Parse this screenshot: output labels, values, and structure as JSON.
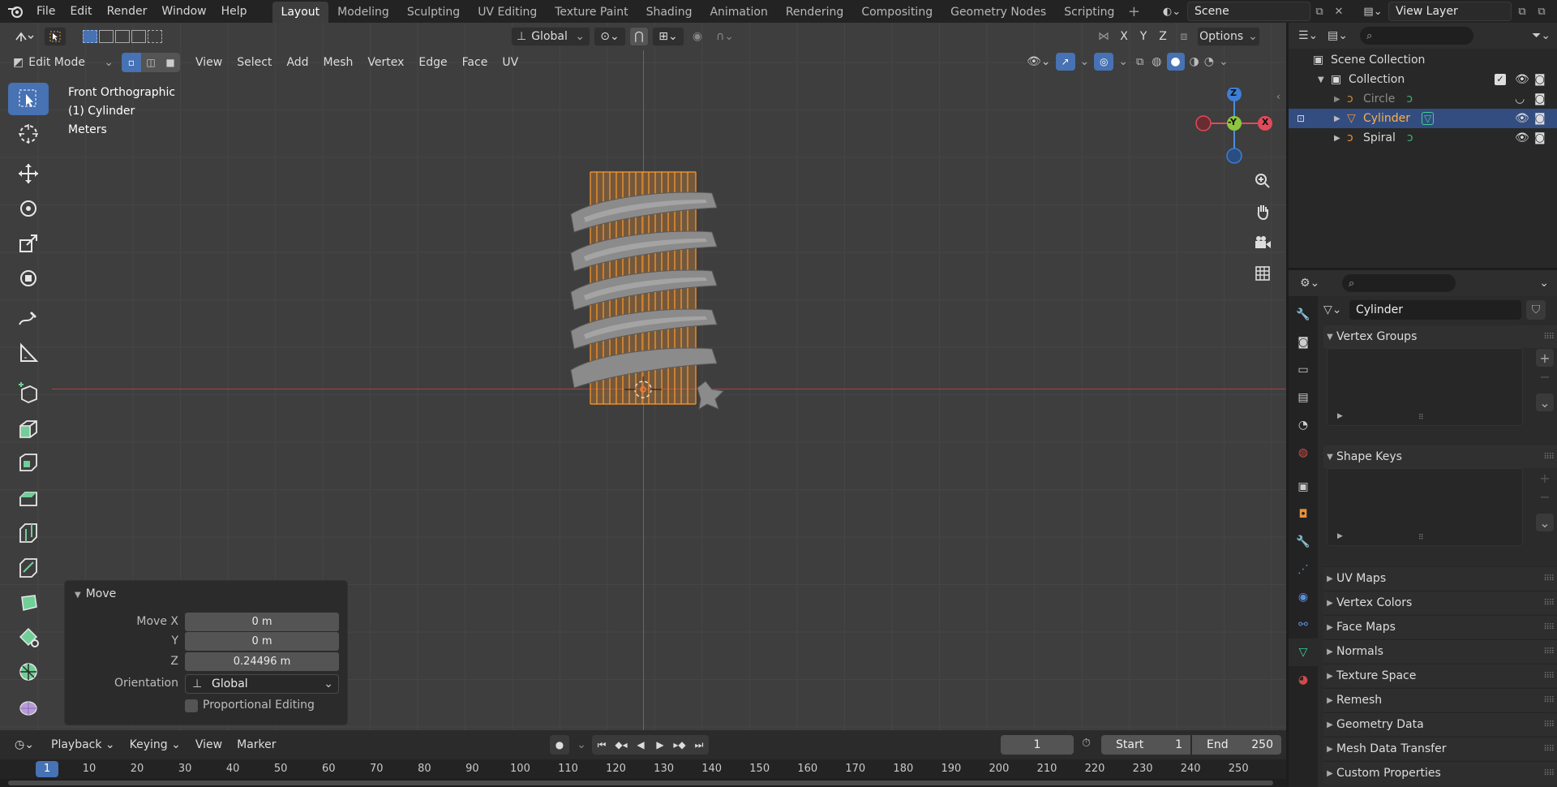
{
  "topbar": {
    "menus": [
      "File",
      "Edit",
      "Render",
      "Window",
      "Help"
    ],
    "workspaces": [
      "Layout",
      "Modeling",
      "Sculpting",
      "UV Editing",
      "Texture Paint",
      "Shading",
      "Animation",
      "Rendering",
      "Compositing",
      "Geometry Nodes",
      "Scripting"
    ],
    "active_workspace": "Layout",
    "add_workspace": "+",
    "scene": "Scene",
    "view_layer": "View Layer"
  },
  "viewport": {
    "transform_orientation": "Global",
    "options_label": "Options",
    "axis_labels": [
      "X",
      "Y",
      "Z"
    ],
    "mode": "Edit Mode",
    "menus": [
      "View",
      "Select",
      "Add",
      "Mesh",
      "Vertex",
      "Edge",
      "Face",
      "UV"
    ],
    "view_name": "Front Orthographic",
    "object_info": "(1) Cylinder",
    "units": "Meters",
    "gizmo": {
      "z": "Z",
      "y": "-Y",
      "x": "X"
    },
    "accent_color": "#4772b3"
  },
  "redo_panel": {
    "title": "Move",
    "move_x_label": "Move X",
    "move_x": "0 m",
    "y_label": "Y",
    "y": "0 m",
    "z_label": "Z",
    "z": "0.24496 m",
    "orientation_label": "Orientation",
    "orientation": "Global",
    "proportional_label": "Proportional Editing"
  },
  "timeline": {
    "menus": [
      "Playback",
      "Keying",
      "View",
      "Marker"
    ],
    "current_frame": "1",
    "start_label": "Start",
    "start": "1",
    "end_label": "End",
    "end": "250",
    "ruler": [
      "1",
      "10",
      "20",
      "30",
      "40",
      "50",
      "60",
      "70",
      "80",
      "90",
      "100",
      "110",
      "120",
      "130",
      "140",
      "150",
      "160",
      "170",
      "180",
      "190",
      "200",
      "210",
      "220",
      "230",
      "240",
      "250"
    ]
  },
  "outliner": {
    "scene_collection": "Scene Collection",
    "collection": "Collection",
    "items": [
      {
        "name": "Circle",
        "selected": false
      },
      {
        "name": "Cylinder",
        "selected": true
      },
      {
        "name": "Spiral",
        "selected": false
      }
    ]
  },
  "properties": {
    "object_name": "Cylinder",
    "vertex_groups": "Vertex Groups",
    "shape_keys": "Shape Keys",
    "subpanels": [
      "UV Maps",
      "Vertex Colors",
      "Face Maps",
      "Normals",
      "Texture Space",
      "Remesh",
      "Geometry Data",
      "Mesh Data Transfer",
      "Custom Properties"
    ]
  }
}
